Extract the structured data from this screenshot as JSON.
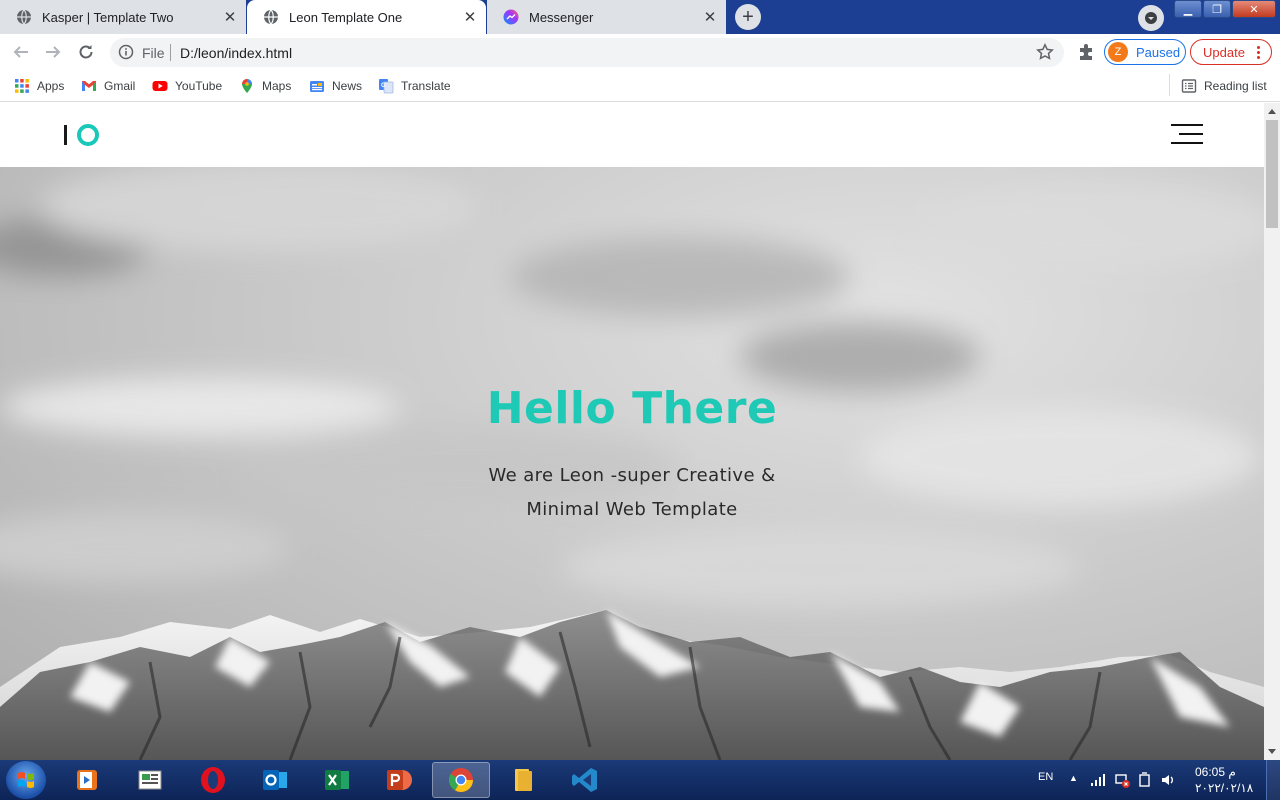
{
  "browser": {
    "tabs": [
      {
        "title": "Kasper | Template Two",
        "active": false
      },
      {
        "title": "Leon Template One",
        "active": true
      },
      {
        "title": "Messenger",
        "active": false
      }
    ],
    "address": {
      "scheme": "File",
      "url": "D:/leon/index.html"
    },
    "profile": {
      "initial": "Z",
      "label": "Paused"
    },
    "update_label": "Update",
    "bookmarks": [
      {
        "label": "Apps",
        "icon": "apps-grid-icon"
      },
      {
        "label": "Gmail",
        "icon": "gmail-icon"
      },
      {
        "label": "YouTube",
        "icon": "youtube-icon"
      },
      {
        "label": "Maps",
        "icon": "maps-pin-icon"
      },
      {
        "label": "News",
        "icon": "news-icon"
      },
      {
        "label": "Translate",
        "icon": "translate-icon"
      }
    ],
    "reading_list": "Reading list"
  },
  "page": {
    "hero": {
      "title": "Hello There",
      "subtitle_line1": "We are Leon -super Creative &",
      "subtitle_line2": "Minimal Web Template"
    }
  },
  "taskbar": {
    "apps": [
      "media-player-icon",
      "file-manager-icon",
      "opera-icon",
      "outlook-icon",
      "excel-icon",
      "powerpoint-icon",
      "chrome-icon",
      "explorer-folder-icon",
      "vscode-icon"
    ],
    "language": "EN",
    "time": "06:05 م",
    "date": "٢٠٢٢/٠٢/١٨"
  },
  "colors": {
    "accent": "#1ec9b5",
    "tabstrip": "#1c3f94",
    "update": "#d93025",
    "paused": "#1a73e8"
  }
}
